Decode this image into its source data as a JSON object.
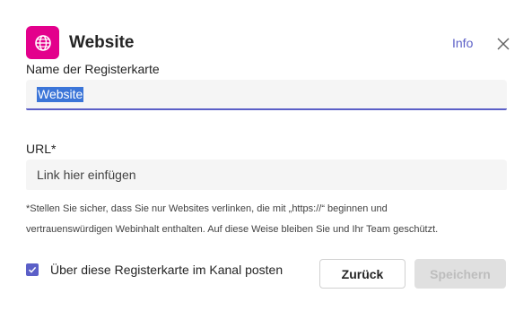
{
  "header": {
    "title": "Website",
    "icon": "globe-icon",
    "icon_bg": "#e3008c",
    "info_label": "Info",
    "close_icon": "close-icon"
  },
  "tab_name": {
    "label": "Name der Registerkarte",
    "value": "Website"
  },
  "url": {
    "label": "URL*",
    "placeholder": "Link hier einfügen"
  },
  "hint": {
    "line1": "*Stellen Sie sicher, dass Sie nur Websites verlinken, die mit „https://“ beginnen und",
    "line2": "vertrauenswürdigen Webinhalt enthalten. Auf diese Weise bleiben Sie und Ihr Team geschützt."
  },
  "post_to_channel": {
    "label": "Über diese Registerkarte im Kanal posten",
    "checked": true
  },
  "buttons": {
    "back_label": "Zurück",
    "save_label": "Speichern"
  },
  "colors": {
    "accent": "#5b5fc7",
    "selection": "#3b75d8"
  }
}
